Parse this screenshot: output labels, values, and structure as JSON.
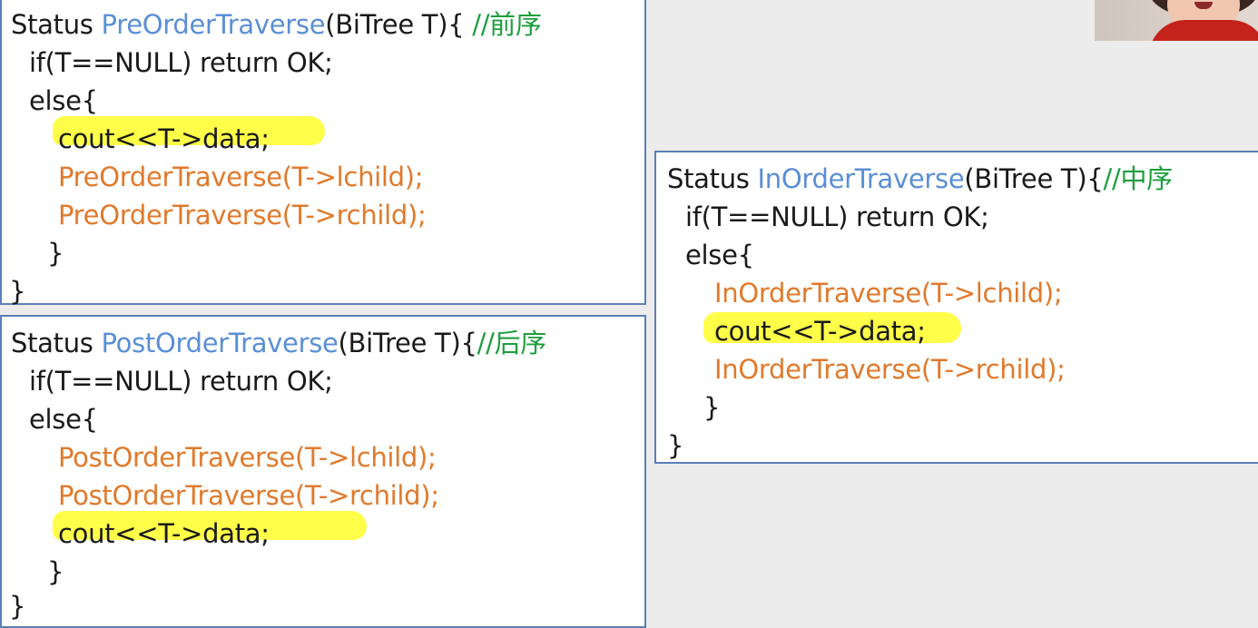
{
  "pre": {
    "kw": "Status ",
    "fn": "PreOrderTraverse",
    "sig": "(BiTree T){ ",
    "comment": "//前序",
    "line2": "if(T==NULL) return OK;",
    "line3": "else{",
    "line4": "cout<<T->data;",
    "line5": "PreOrderTraverse(T->lchild);",
    "line6": "PreOrderTraverse(T->rchild);",
    "line7": "}",
    "line8": "}"
  },
  "post": {
    "kw": "Status ",
    "fn": "PostOrderTraverse",
    "sig": "(BiTree T){",
    "comment": "//后序",
    "line2": "if(T==NULL) return OK;",
    "line3": "else{",
    "line4": "PostOrderTraverse(T->lchild);",
    "line5": "PostOrderTraverse(T->rchild);",
    "line6": "cout<<T->data;",
    "line7": "}",
    "line8": "}"
  },
  "in": {
    "kw": "Status ",
    "fn": "InOrderTraverse",
    "sig": "(BiTree T){",
    "comment": "//中序",
    "line2": "if(T==NULL) return OK;",
    "line3": "else{",
    "line4": "InOrderTraverse(T->lchild);",
    "line5": "cout<<T->data;",
    "line6": "InOrderTraverse(T->rchild);",
    "line7": "}",
    "line8": "}"
  },
  "colors": {
    "function_name": "#5b8fd6",
    "recursive_call": "#e07a2c",
    "comment": "#1e9e3e",
    "highlight": "#ffff3a",
    "border": "#5b7fb8"
  }
}
